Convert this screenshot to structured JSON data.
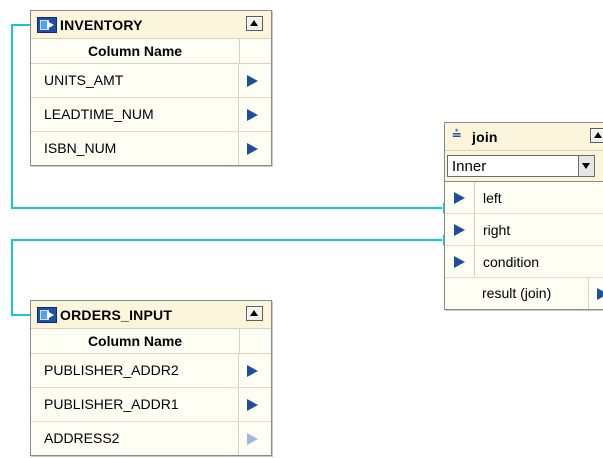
{
  "colors": {
    "link": "#19c6d6",
    "port": "#1e4f9c",
    "header_bg": "#fbf5dc",
    "body_bg": "#fffef5"
  },
  "inventory": {
    "name": "INVENTORY",
    "column_header": "Column Name",
    "rows": [
      "UNITS_AMT",
      "LEADTIME_NUM",
      "ISBN_NUM"
    ]
  },
  "orders_input": {
    "name": "ORDERS_INPUT",
    "column_header": "Column Name",
    "rows": [
      "PUBLISHER_ADDR2",
      "PUBLISHER_ADDR1",
      "ADDRESS2"
    ]
  },
  "join": {
    "name": "join",
    "join_type": "Inner",
    "inputs": [
      "left",
      "right",
      "condition"
    ],
    "output": "result (join)"
  }
}
